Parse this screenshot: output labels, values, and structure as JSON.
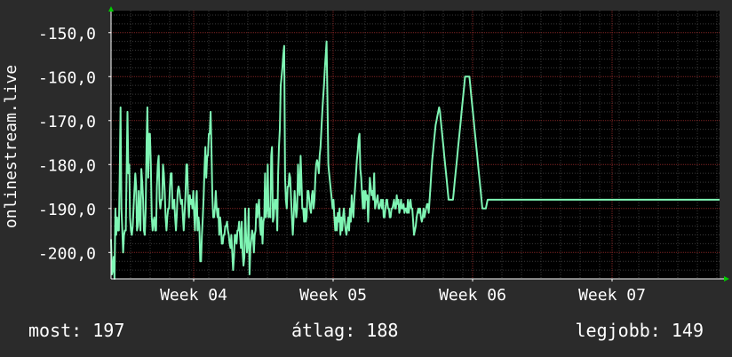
{
  "colors": {
    "background": "#2b2b2b",
    "plot_background": "#000000",
    "line": "#7ff5b4",
    "major_grid": "#7a2222",
    "minor_grid": "#3a3a3a",
    "axis": "#ffffff",
    "arrow": "#00cc00"
  },
  "chart_data": {
    "type": "line",
    "ylabel": "onlinestream.live",
    "ylim": [
      -206,
      -145
    ],
    "yticks": [
      -150,
      -160,
      -170,
      -180,
      -190,
      -200
    ],
    "ytick_labels": [
      "-150,0",
      "-160,0",
      "-170,0",
      "-180,0",
      "-190,0",
      "-200,0"
    ],
    "xlim": [
      0,
      685
    ],
    "xticks": [
      93,
      250,
      407,
      564
    ],
    "xtick_labels": [
      "Week 04",
      "Week 05",
      "Week 06",
      "Week 07"
    ],
    "grid": true,
    "series": [
      {
        "values": [
          -197,
          -205,
          -204,
          -201,
          -206,
          -190,
          -196,
          -192,
          -195,
          -195,
          -183,
          -167,
          -190,
          -195,
          -200,
          -196,
          -195,
          -195,
          -182,
          -168,
          -182,
          -180,
          -192,
          -195,
          -196,
          -194,
          -190,
          -186,
          -182,
          -185,
          -195,
          -194,
          -186,
          -192,
          -195,
          -181,
          -184,
          -188,
          -195,
          -196,
          -190,
          -175,
          -167,
          -183,
          -173,
          -173,
          -180,
          -192,
          -195,
          -193,
          -192,
          -195,
          -195,
          -185,
          -180,
          -178,
          -188,
          -190,
          -188,
          -188,
          -180,
          -182,
          -186,
          -192,
          -195,
          -192,
          -190,
          -190,
          -185,
          -182,
          -182,
          -190,
          -190,
          -188,
          -192,
          -195,
          -191,
          -186,
          -185,
          -186,
          -188,
          -189,
          -188,
          -192,
          -195,
          -191,
          -187,
          -180,
          -180,
          -188,
          -192,
          -187,
          -189,
          -188,
          -190,
          -186,
          -191,
          -195,
          -189,
          -186,
          -195,
          -192,
          -194,
          -202,
          -202,
          -196,
          -192,
          -187,
          -181,
          -176,
          -183,
          -178,
          -178,
          -173,
          -173,
          -168,
          -176,
          -187,
          -192,
          -192,
          -190,
          -186,
          -190,
          -192,
          -190,
          -196,
          -192,
          -194,
          -198,
          -198,
          -196,
          -196,
          -194,
          -194,
          -193,
          -195,
          -196,
          -198,
          -199,
          -196,
          -200,
          -204,
          -201,
          -196,
          -196,
          -198,
          -195,
          -195,
          -193,
          -196,
          -199,
          -193,
          -200,
          -203,
          -201,
          -190,
          -196,
          -200,
          -198,
          -190,
          -205,
          -199,
          -197,
          -195,
          -196,
          -200,
          -196,
          -195,
          -189,
          -192,
          -190,
          -188,
          -194,
          -196,
          -192,
          -198,
          -193,
          -192,
          -182,
          -192,
          -190,
          -180,
          -192,
          -190,
          -192,
          -178,
          -176,
          -193,
          -192,
          -188,
          -190,
          -188,
          -195,
          -182,
          -176,
          -172,
          -162,
          -160,
          -158,
          -155,
          -153,
          -183,
          -188,
          -190,
          -185,
          -185,
          -182,
          -183,
          -188,
          -192,
          -196,
          -192,
          -186,
          -189,
          -192,
          -190,
          -180,
          -185,
          -187,
          -178,
          -184,
          -190,
          -190,
          -193,
          -190,
          -193,
          -192,
          -186,
          -186,
          -188,
          -190,
          -191,
          -187,
          -186,
          -190,
          -188,
          -183,
          -180,
          -179,
          -180,
          -182,
          -178,
          -176,
          -172,
          -168,
          -165,
          -162,
          -158,
          -155,
          -152,
          -165,
          -180,
          -182,
          -184,
          -186,
          -188,
          -190,
          -188,
          -192,
          -195,
          -192,
          -195,
          -191,
          -193,
          -190,
          -196,
          -192,
          -195,
          -192,
          -190,
          -193,
          -195,
          -196,
          -194,
          -192,
          -195,
          -190,
          -193,
          -187,
          -190,
          -192,
          -188,
          -185,
          -182,
          -179,
          -177,
          -174,
          -173,
          -181,
          -183,
          -187,
          -190,
          -186,
          -190,
          -186,
          -188,
          -187,
          -193,
          -188,
          -183,
          -185,
          -187,
          -186,
          -188,
          -182,
          -190,
          -189,
          -188,
          -187,
          -190,
          -190,
          -189,
          -188,
          -190,
          -188,
          -192,
          -192,
          -190,
          -188,
          -188,
          -190,
          -190,
          -192,
          -192,
          -190,
          -190,
          -189,
          -188,
          -190,
          -190,
          -187,
          -189,
          -188,
          -191,
          -190,
          -188,
          -190,
          -190,
          -189,
          -191,
          -190,
          -190,
          -191,
          -188,
          -191,
          -189,
          -188,
          -190,
          -190,
          -193,
          -196,
          -195,
          -194,
          -192,
          -191,
          -190,
          -191,
          -190,
          -192,
          -193,
          -192,
          -190,
          -192,
          -191,
          -190,
          -189,
          -189,
          -191,
          -188,
          -185,
          -182,
          -179,
          -177,
          -175,
          -173,
          -171,
          -170,
          -169,
          -168,
          -167,
          -168,
          -170,
          -172,
          -174,
          -176,
          -178,
          -180,
          -182,
          -184,
          -186,
          -188,
          -188,
          -188,
          -188,
          -188,
          -188,
          -186,
          -184,
          -182,
          -180,
          -178,
          -176,
          -174,
          -172,
          -170,
          -168,
          -166,
          -164,
          -162,
          -160,
          -160,
          -160,
          -160,
          -160,
          -160,
          -162,
          -164,
          -166,
          -168,
          -170,
          -172,
          -174,
          -176,
          -178,
          -180,
          -182,
          -184,
          -186,
          -188,
          -190,
          -190,
          -190,
          -190,
          -190,
          -189,
          -188,
          -188,
          -188,
          -188,
          -188,
          -188,
          -188,
          -188,
          -188,
          -188,
          -188,
          -188,
          -188,
          -188,
          -188,
          -188,
          -188,
          -188,
          -188,
          -188,
          -188,
          -188,
          -188,
          -188,
          -188,
          -188,
          -188,
          -188,
          -188,
          -188,
          -188,
          -188,
          -188,
          -188,
          -188,
          -188,
          -188,
          -188,
          -188,
          -188,
          -188,
          -188,
          -188,
          -188,
          -188,
          -188,
          -188,
          -188,
          -188,
          -188,
          -188,
          -188,
          -188,
          -188,
          -188,
          -188,
          -188,
          -188,
          -188,
          -188,
          -188,
          -188,
          -188,
          -188,
          -188,
          -188,
          -188,
          -188,
          -188,
          -188,
          -188,
          -188,
          -188,
          -188,
          -188,
          -188,
          -188,
          -188,
          -188,
          -188,
          -188,
          -188,
          -188,
          -188,
          -188,
          -188,
          -188,
          -188,
          -188,
          -188,
          -188,
          -188,
          -188,
          -188,
          -188,
          -188,
          -188,
          -188,
          -188,
          -188,
          -188,
          -188,
          -188,
          -188,
          -188,
          -188,
          -188,
          -188,
          -188,
          -188,
          -188,
          -188,
          -188,
          -188,
          -188,
          -188,
          -188,
          -188,
          -188,
          -188,
          -188,
          -188,
          -188,
          -188,
          -188,
          -188,
          -188,
          -188,
          -188,
          -188,
          -188,
          -188,
          -188,
          -188,
          -188,
          -188,
          -188,
          -188,
          -188,
          -188,
          -188,
          -188,
          -188,
          -188,
          -188,
          -188,
          -188,
          -188,
          -188,
          -188,
          -188,
          -188,
          -188,
          -188,
          -188,
          -188,
          -188,
          -188,
          -188,
          -188,
          -188,
          -188,
          -188,
          -188,
          -188,
          -188,
          -188,
          -188,
          -188,
          -188,
          -188,
          -188,
          -188,
          -188,
          -188,
          -188,
          -188,
          -188,
          -188,
          -188,
          -188,
          -188,
          -188,
          -188,
          -188,
          -188,
          -188,
          -188,
          -188,
          -188,
          -188,
          -188,
          -188,
          -188,
          -188,
          -188,
          -188,
          -188,
          -188,
          -188,
          -188,
          -188,
          -188,
          -188,
          -188,
          -188,
          -188,
          -188,
          -188,
          -188,
          -188,
          -188,
          -188,
          -188,
          -188,
          -188,
          -188,
          -188,
          -188,
          -188,
          -188,
          -188,
          -188,
          -188,
          -188,
          -188,
          -188,
          -188,
          -188,
          -188,
          -188,
          -188,
          -188,
          -188,
          -188,
          -188,
          -188,
          -188,
          -188,
          -188,
          -188,
          -188,
          -188,
          -188,
          -188,
          -188,
          -188,
          -188,
          -188,
          -188,
          -188,
          -188,
          -188,
          -188,
          -188,
          -188,
          -188,
          -188,
          -188,
          -188,
          -188,
          -188,
          -188,
          -188,
          -188,
          -188,
          -188,
          -188,
          -188
        ]
      }
    ]
  },
  "stats": [
    "most: 197",
    "átlag: 188",
    "legjobb: 149"
  ]
}
